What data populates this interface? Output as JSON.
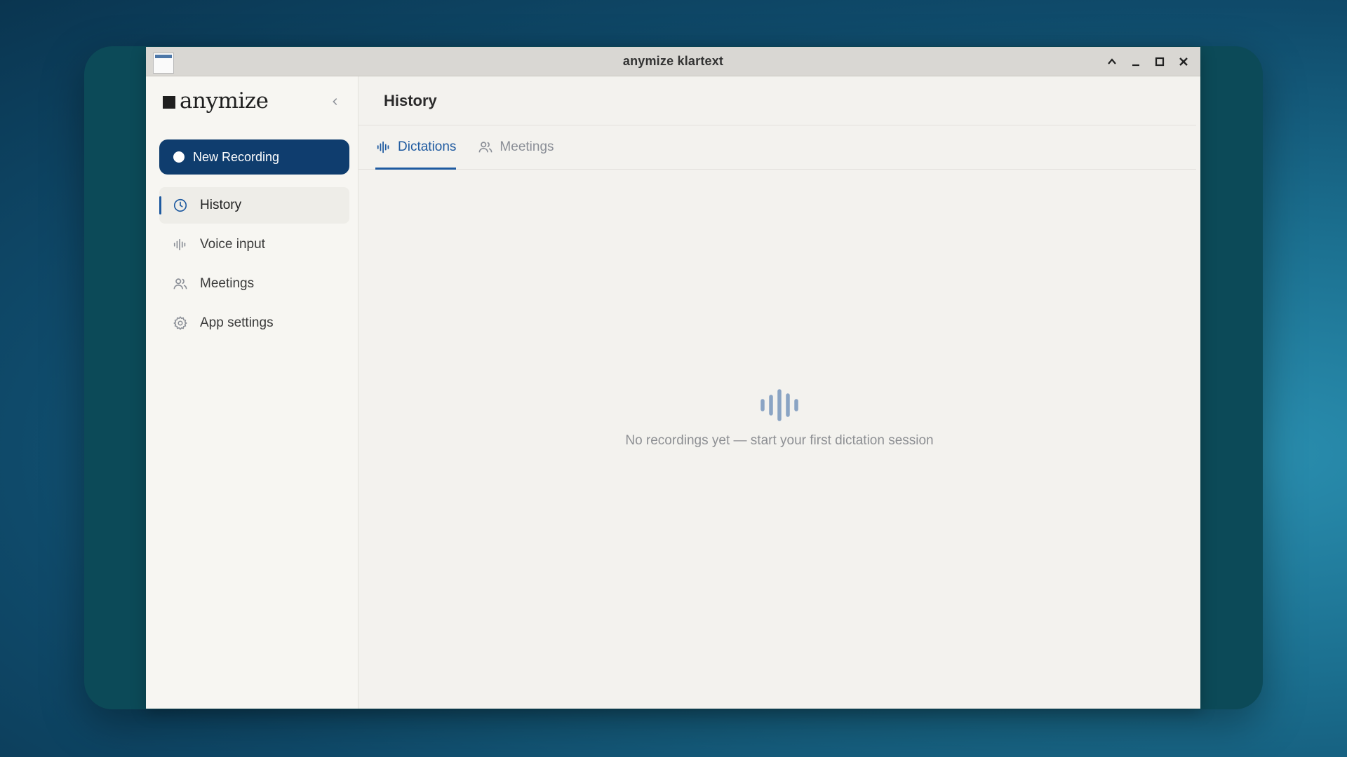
{
  "window": {
    "title": "anymize klartext"
  },
  "sidebar": {
    "logo_text": "anymize",
    "new_recording_label": "New Recording",
    "items": [
      {
        "label": "History",
        "icon": "clock-icon",
        "active": true
      },
      {
        "label": "Voice input",
        "icon": "waveform-icon",
        "active": false
      },
      {
        "label": "Meetings",
        "icon": "users-icon",
        "active": false
      },
      {
        "label": "App settings",
        "icon": "gear-icon",
        "active": false
      }
    ]
  },
  "main": {
    "title": "History",
    "tabs": [
      {
        "label": "Dictations",
        "icon": "waveform-icon",
        "active": true
      },
      {
        "label": "Meetings",
        "icon": "users-icon",
        "active": false
      }
    ],
    "empty_state": {
      "icon": "waveform-icon",
      "message": "No recordings yet — start your first dictation session"
    }
  },
  "colors": {
    "accent": "#1e5aa0",
    "button_primary": "#0f3d6e",
    "muted_text": "#8d8f93"
  }
}
